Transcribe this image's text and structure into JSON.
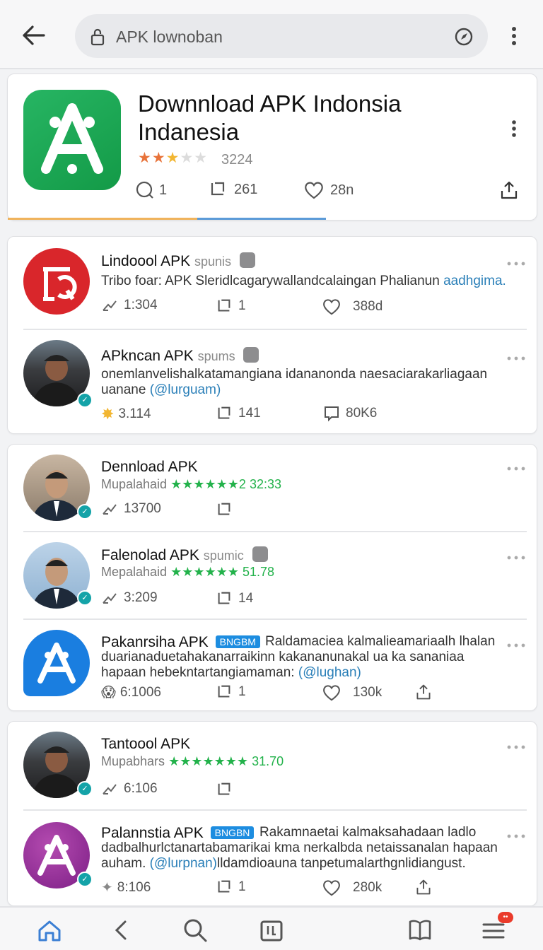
{
  "topbar": {
    "search_text": "APK lownoban"
  },
  "hero": {
    "title": "Downnload APK Indonsia Indanesia",
    "stars": "★★★★★",
    "rating": "3224",
    "comments": "1",
    "reposts": "261",
    "likes": "28n"
  },
  "posts": [
    {
      "name": "Lindoool APK",
      "handle": "spunis",
      "text": "Tribo foar: APK Sleridlcagarywallandcalaingan Phalianun",
      "link": "aadhgima.",
      "stat1": "1:304",
      "stat2": "1",
      "stat3": "388d"
    },
    {
      "name": "APkncan APK",
      "handle": "spums",
      "text": "onemlanvelishalkatamangiana idananonda naesaciarakarliagaan uanane",
      "link": "(@lurguam)",
      "stat1": "3.114",
      "stat2": "141",
      "stat3": "80K6"
    },
    {
      "name": "Dennload APK",
      "meta": "Mupalahaid",
      "stars": "★★★★★★2",
      "score": "32:33",
      "stat1": "13700"
    },
    {
      "name": "Falenolad APK",
      "handle": "spumic",
      "meta": "Mepalahaid",
      "stars": "★★★★★★",
      "score": "51.78",
      "stat1": "3:209",
      "stat2": "14"
    },
    {
      "name": "Pakanrsiha APK",
      "tag": "BNGBM",
      "text": "Raldamaciea kalmalieamariaalh lhalan duarianaduetahakanarraikinn kakananunakal ua ka sananiaa hapaan hebekntartangiamaman:",
      "link": "(@lughan)",
      "stat1": "6:1006",
      "stat2": "1",
      "stat3": "130k"
    },
    {
      "name": "Tantoool APK",
      "meta": "Mupabhars",
      "stars": "★★★★★★★",
      "score": "31.70",
      "stat1": "6:106"
    },
    {
      "name": "Palannstia APK",
      "tag": "BNGBN",
      "text": "Rakamnaetai kalmaksahadaan ladlo dadbalhurlctanartabamarikai kma nerkalbda netaissanalan hapaan auham.",
      "link": "(@lurpnan)",
      "text2": "lldamdioauna tanpetumalarthgnlidiangust.",
      "stat1": "8:106",
      "stat2": "1",
      "stat3": "280k"
    }
  ],
  "colors": {
    "accent": "#1d8de0",
    "green": "#23b24b",
    "link": "#2a7fb8"
  }
}
